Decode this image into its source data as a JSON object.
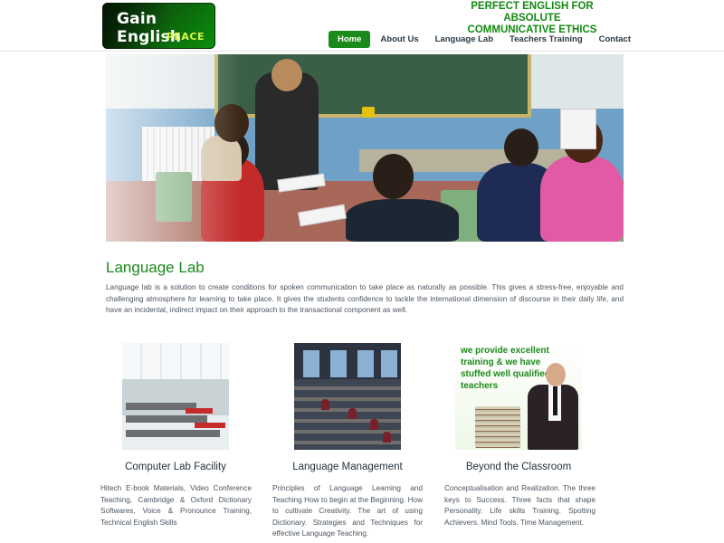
{
  "logo": {
    "title": "Gain English",
    "subtitle": "PEACE"
  },
  "tagline": {
    "line1": "PERFECT ENGLISH FOR ABSOLUTE",
    "line2": "COMMUNICATIVE ETHICS"
  },
  "nav": {
    "items": [
      "Home",
      "About Us",
      "Language Lab",
      "Teachers Training",
      "Contact"
    ],
    "active": "Home",
    "accent": "#1a8a1a"
  },
  "section": {
    "title": "Language Lab",
    "text": "Language lab is a solution to create conditions for spoken communication to take place as naturally as possible. This gives a stress-free, enjoyable and challenging atmosphere for learning to take place. It gives the students confidence to tackle the international dimension of discourse in their daily life, and have an incidental, indirect impact on their approach to the transactional component as well."
  },
  "cards": [
    {
      "title": "Computer Lab Facility",
      "text": "Hitech E-book Materials, Video Conference Teaching, Cambridge & Oxford Dictionary Softwares, Voice & Pronounce Training, Technical English Skills"
    },
    {
      "title": "Language Management",
      "text": "Principles of Language Learning and Teaching How to begin at the Beginning. How to cultivate Creativity. The art of using Dictionary. Strategies and Techniques for effective Language Teaching."
    },
    {
      "title": "Beyond the Classroom",
      "text": "Conceptualisation and Realization. The three keys to Success. Three facts that shape Personality. Life skills Training. Spotting Achievers. Mind Tools. Time Management.",
      "image_text": "we provide excellent training & we have stuffed well qualified teachers"
    }
  ]
}
